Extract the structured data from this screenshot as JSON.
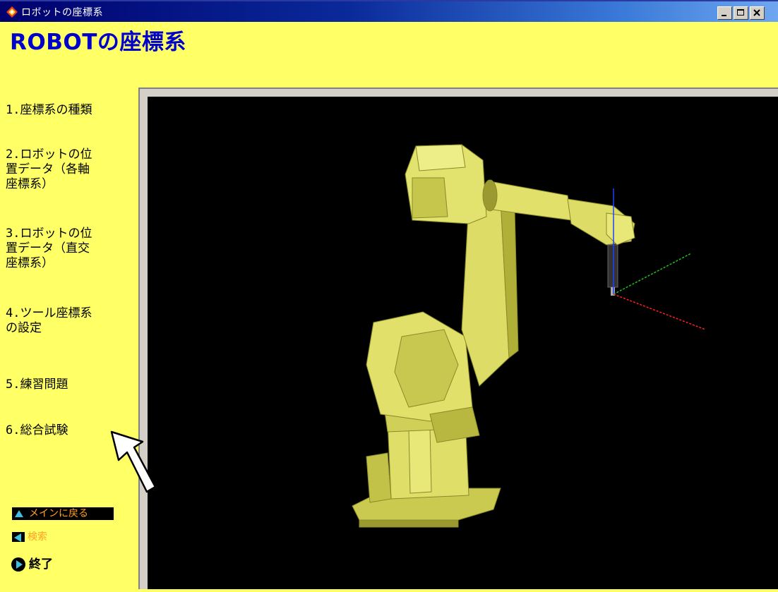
{
  "window": {
    "title": "ロボットの座標系",
    "icon": "app-icon",
    "controls": [
      "minimize-icon",
      "maximize-icon",
      "close-icon"
    ]
  },
  "page": {
    "title": "ROBOTの座標系"
  },
  "sidebar": {
    "items": [
      {
        "label": "1.座標系の種類"
      },
      {
        "label": "2.ロボットの位\n置データ（各軸\n座標系）"
      },
      {
        "label": "3.ロボットの位\n置データ（直交\n座標系）"
      },
      {
        "label": "4.ツール座標系\nの設定"
      },
      {
        "label": "5.練習問題"
      },
      {
        "label": "6.総合試験"
      }
    ],
    "main_button": "メインに戻る",
    "search_button": "検索",
    "exit_button": "終了"
  },
  "viewport": {
    "content": "3D robot arm model",
    "background": "#000000",
    "robot_color": "#e0e070",
    "axes_colors": {
      "x": "#ff2020",
      "y": "#20c020",
      "z": "#2040ff"
    }
  },
  "colors": {
    "page_background": "#ffff66",
    "title_text": "#0000cc",
    "button_text": "#ffa020",
    "titlebar": "#0a2a9a"
  }
}
